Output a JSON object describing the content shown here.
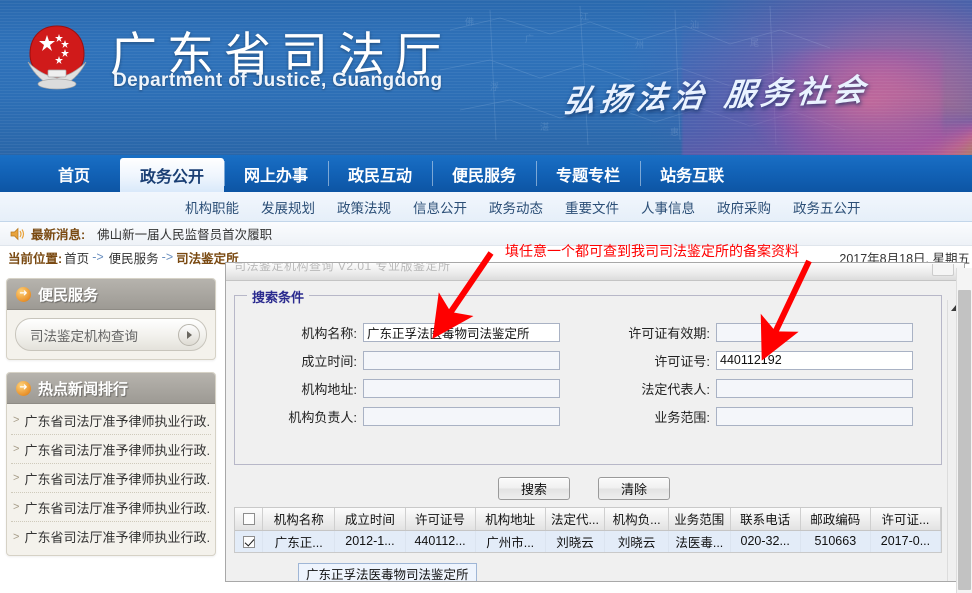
{
  "banner": {
    "title_cn": "广东省司法厅",
    "title_en": "Department of Justice, Guangdong",
    "calligraphy": "弘扬法治  服务社会",
    "emblem_name": "national-emblem"
  },
  "nav": {
    "items": [
      {
        "label": "首页",
        "active": false
      },
      {
        "label": "政务公开",
        "active": true
      },
      {
        "label": "网上办事",
        "active": false
      },
      {
        "label": "政民互动",
        "active": false
      },
      {
        "label": "便民服务",
        "active": false
      },
      {
        "label": "专题专栏",
        "active": false
      },
      {
        "label": "站务互联",
        "active": false
      }
    ]
  },
  "subnav": {
    "items": [
      "机构职能",
      "发展规划",
      "政策法规",
      "信息公开",
      "政务动态",
      "重要文件",
      "人事信息",
      "政府采购",
      "政务五公开"
    ]
  },
  "ticker": {
    "icon": "speaker-icon",
    "label": "最新消息:",
    "text": "佛山新一届人民监督员首次履职",
    "date": "2017年8月18日, 星期五"
  },
  "breadcrumb": {
    "label": "当前位置:",
    "home": "首页",
    "sep": "->",
    "parent": "便民服务",
    "current": "司法鉴定所"
  },
  "sidebar": {
    "service_panel": {
      "title": "便民服务",
      "combo_value": "司法鉴定机构查询"
    },
    "news_panel": {
      "title": "热点新闻排行",
      "items": [
        "广东省司法厅准予律师执业行政...",
        "广东省司法厅准予律师执业行政...",
        "广东省司法厅准予律师执业行政...",
        "广东省司法厅准予律师执业行政...",
        "广东省司法厅准予律师执业行政..."
      ]
    }
  },
  "window": {
    "title_ghost": "司法鉴定机构查询 V2.01 专业版鉴定所"
  },
  "form": {
    "legend": "搜索条件",
    "left_fields": [
      {
        "label": "机构名称:",
        "value": "广东正孚法医毒物司法鉴定所"
      },
      {
        "label": "成立时间:",
        "value": ""
      },
      {
        "label": "机构地址:",
        "value": ""
      },
      {
        "label": "机构负责人:",
        "value": ""
      }
    ],
    "right_fields": [
      {
        "label": "许可证有效期:",
        "value": ""
      },
      {
        "label": "许可证号:",
        "value": "440112192"
      },
      {
        "label": "法定代表人:",
        "value": ""
      },
      {
        "label": "业务范围:",
        "value": ""
      }
    ],
    "search_button": "搜索",
    "clear_button": "清除"
  },
  "table": {
    "columns": [
      "",
      "机构名称",
      "成立时间",
      "许可证号",
      "机构地址",
      "法定代...",
      "机构负...",
      "业务范围",
      "联系电话",
      "邮政编码",
      "许可证..."
    ],
    "rows": [
      {
        "checked": true,
        "cells": [
          "广东正...",
          "2012-1...",
          "440112...",
          "广州市...",
          "刘晓云",
          "刘晓云",
          "法医毒...",
          "020-32...",
          "510663",
          "2017-0..."
        ]
      }
    ]
  },
  "chip": {
    "label": "广东正孚法医毒物司法鉴定所"
  },
  "annotation": {
    "text": "填任意一个都可查到我司司法鉴定所的备案资料",
    "color": "#ff0000"
  }
}
